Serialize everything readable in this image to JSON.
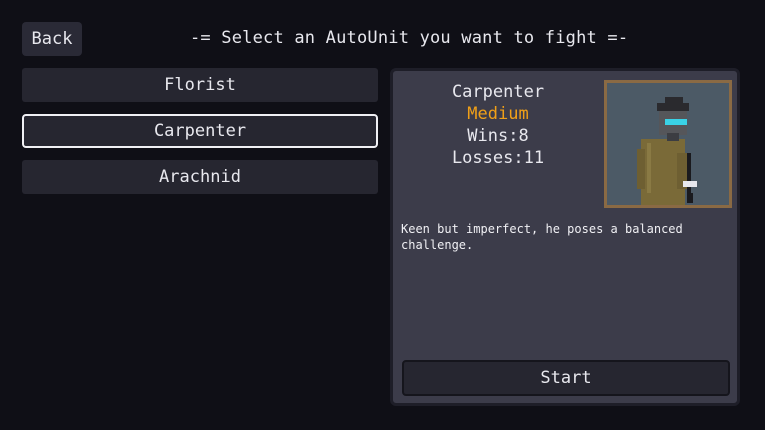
{
  "back_label": "Back",
  "header_title": "-= Select an AutoUnit you want to fight =-",
  "units": [
    {
      "label": "Florist",
      "selected": false
    },
    {
      "label": "Carpenter",
      "selected": true
    },
    {
      "label": "Arachnid",
      "selected": false
    }
  ],
  "detail": {
    "name": "Carpenter",
    "difficulty": "Medium",
    "wins": "Wins:8",
    "losses": "Losses:11",
    "description": "Keen but imperfect, he poses a balanced challenge.",
    "start_label": "Start",
    "difficulty_color": "#f0a018",
    "portrait_icon": "carpenter-robot-portrait"
  }
}
